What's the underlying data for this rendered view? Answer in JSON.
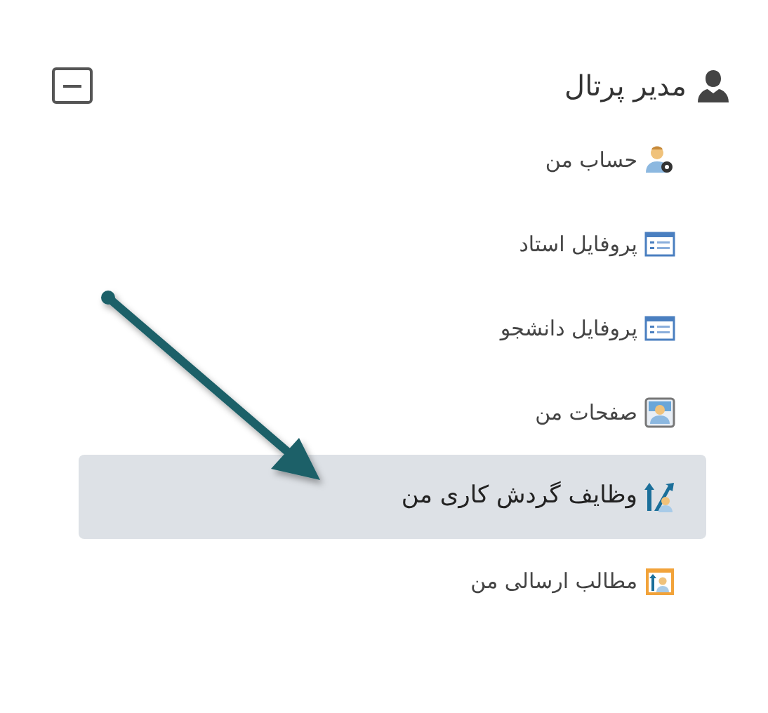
{
  "header": {
    "title": "مدیر پرتال",
    "expanded": true
  },
  "items": [
    {
      "label": "حساب من",
      "kind": "account",
      "selected": false
    },
    {
      "label": "پروفایل استاد",
      "kind": "form",
      "selected": false
    },
    {
      "label": "پروفایل دانشجو",
      "kind": "form",
      "selected": false
    },
    {
      "label": "صفحات من",
      "kind": "portrait",
      "selected": false
    },
    {
      "label": "وظایف گردش کاری من",
      "kind": "workflow",
      "selected": true
    },
    {
      "label": "مطالب ارسالی من",
      "kind": "sent",
      "selected": false
    }
  ]
}
